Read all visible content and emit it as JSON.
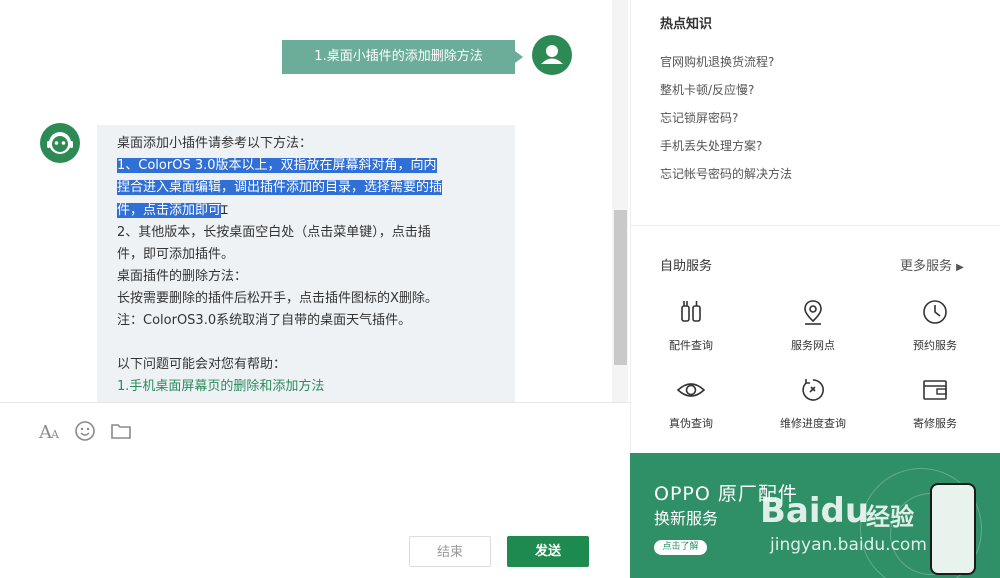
{
  "chat": {
    "user_message": "1.桌面小插件的添加删除方法",
    "bot_message": {
      "line1": "桌面添加小插件请参考以下方法：",
      "hl1": "1、ColorOS 3.0版本以上，双指放在屏幕斜对角，向内",
      "hl2": "捏合进入桌面编辑，调出插件添加的目录，选择需要的插",
      "hl3": "件，点击添加即可",
      "line5": "2、其他版本，长按桌面空白处（点击菜单键），点击插",
      "line6": "件，即可添加插件。",
      "line7": "桌面插件的删除方法：",
      "line8": "长按需要删除的插件后松开手，点击插件图标的X删除。",
      "line9": "注：ColorOS3.0系统取消了自带的桌面天气插件。",
      "line10": "以下问题可能会对您有帮助：",
      "link1": "1.手机桌面屏幕页的删除和添加方法"
    }
  },
  "input": {
    "end_label": "结束",
    "send_label": "发送"
  },
  "hot": {
    "title": "热点知识",
    "items": [
      "官网购机退换货流程?",
      "整机卡顿/反应慢?",
      "忘记锁屏密码?",
      "手机丢失处理方案?",
      "忘记帐号密码的解决方法"
    ]
  },
  "services": {
    "title": "自助服务",
    "more": "更多服务",
    "items": [
      {
        "label": "配件查询",
        "icon": "accessory-icon"
      },
      {
        "label": "服务网点",
        "icon": "location-pin-icon"
      },
      {
        "label": "预约服务",
        "icon": "clock-icon"
      },
      {
        "label": "真伪查询",
        "icon": "eye-icon"
      },
      {
        "label": "维修进度查询",
        "icon": "repair-progress-icon"
      },
      {
        "label": "寄修服务",
        "icon": "wallet-icon"
      }
    ]
  },
  "banner": {
    "title": "OPPO 原厂配件",
    "subtitle": "换新服务",
    "cta": "点击了解"
  },
  "watermark": {
    "brand": "Baidu",
    "cn": "经验",
    "url": "jingyan.baidu.com"
  },
  "colors": {
    "accent": "#1d8a4f",
    "user_bubble": "#6cad9a",
    "highlight": "#2f6fd6",
    "banner": "#2f8f67"
  }
}
